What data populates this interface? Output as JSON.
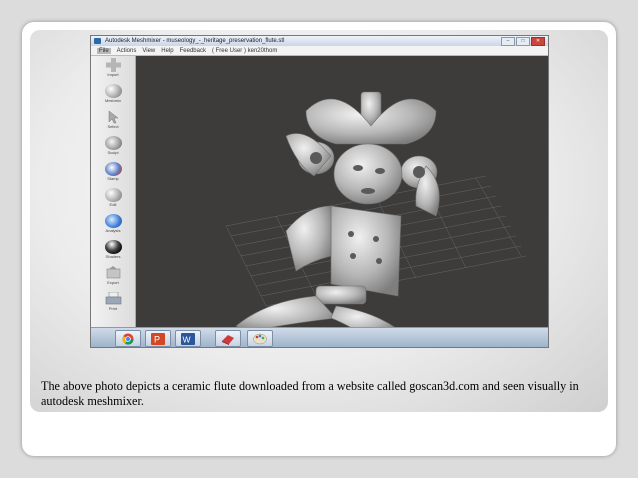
{
  "app": {
    "title": "Autodesk Meshmixer - museology_-_heritage_preservation_flute.stl",
    "window_buttons": [
      "–",
      "□",
      "✕"
    ]
  },
  "menu": {
    "items": [
      "File",
      "Actions",
      "View",
      "Help",
      "Feedback",
      "( Free User ) ken20thom"
    ]
  },
  "toolbar": {
    "tools": [
      {
        "label": "Import",
        "icon": "plus-icon"
      },
      {
        "label": "Meshmix",
        "icon": "meshmix-icon"
      },
      {
        "label": "Select",
        "icon": "select-arrow-icon"
      },
      {
        "label": "Sculpt",
        "icon": "sculpt-brush-icon"
      },
      {
        "label": "Stamp",
        "icon": "stamp-icon"
      },
      {
        "label": "Edit",
        "icon": "edit-icon"
      },
      {
        "label": "Analysis",
        "icon": "analysis-icon"
      },
      {
        "label": "Shaders",
        "icon": "shader-sphere-icon"
      },
      {
        "label": "Export",
        "icon": "export-icon"
      },
      {
        "label": "Print",
        "icon": "printer-icon"
      }
    ]
  },
  "taskbar": {
    "items": [
      "chrome-icon",
      "powerpoint-icon",
      "word-icon",
      "app-icon",
      "paint-icon"
    ]
  },
  "caption": "The above photo depicts a ceramic flute downloaded from a website called goscan3d.com and seen visually in autodesk meshmixer."
}
